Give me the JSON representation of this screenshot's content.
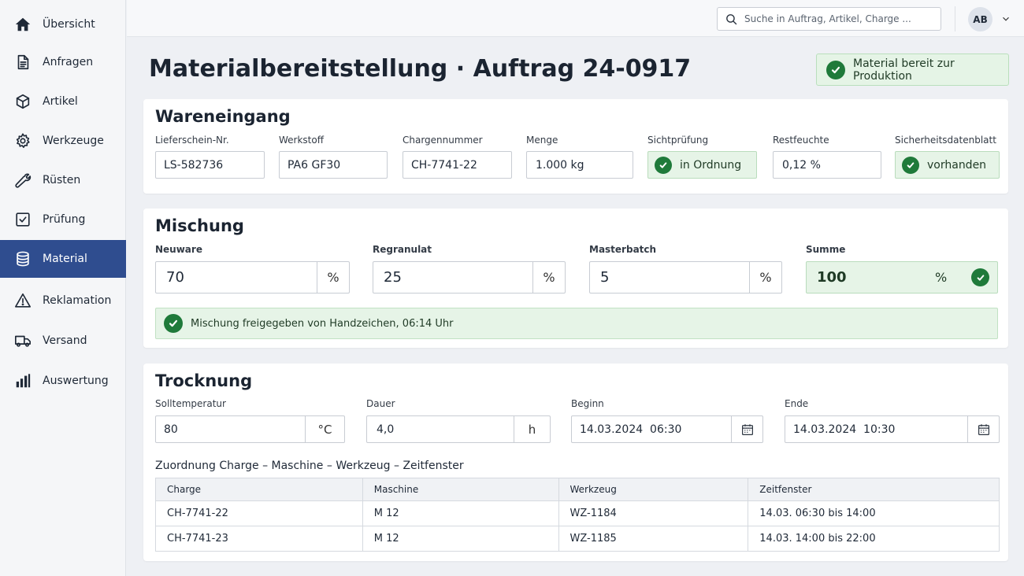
{
  "sidebar": {
    "items": [
      {
        "label": "Übersicht",
        "icon": "home-icon"
      },
      {
        "label": "Anfragen",
        "icon": "document-icon"
      },
      {
        "label": "Artikel",
        "icon": "box-icon"
      },
      {
        "label": "Werkzeuge",
        "icon": "gear-icon"
      },
      {
        "label": "Rüsten",
        "icon": "wrench-icon"
      },
      {
        "label": "Prüfung",
        "icon": "checkbox-icon"
      },
      {
        "label": "Material",
        "icon": "database-icon",
        "active": true
      },
      {
        "label": "Reklamation",
        "icon": "warning-icon"
      },
      {
        "label": "Versand",
        "icon": "truck-icon"
      },
      {
        "label": "Auswertung",
        "icon": "bar-chart-icon"
      }
    ]
  },
  "topbar": {
    "search_placeholder": "Suche in Auftrag, Artikel, Charge ...",
    "avatar_initials": "AB"
  },
  "page": {
    "title": "Materialbereitstellung · Auftrag 24-0917",
    "status": "Material bereit zur Produktion"
  },
  "wareneingang": {
    "heading": "Wareneingang",
    "lieferschein": {
      "label": "Lieferschein-Nr.",
      "value": "LS-582736"
    },
    "werkstoff": {
      "label": "Werkstoff",
      "value": "PA6 GF30"
    },
    "charge": {
      "label": "Chargennummer",
      "value": "CH-7741-22"
    },
    "menge": {
      "label": "Menge",
      "value": "1.000 kg"
    },
    "sichtpruefung": {
      "label": "Sichtprüfung",
      "value": "in Ordnung"
    },
    "restfeuchte": {
      "label": "Restfeuchte",
      "value": "0,12 %"
    },
    "sdb": {
      "label": "Sicherheitsdatenblatt",
      "value": "vorhanden"
    }
  },
  "mischung": {
    "heading": "Mischung",
    "neuware": {
      "label": "Neuware",
      "value": "70",
      "unit": "%"
    },
    "regranulat": {
      "label": "Regranulat",
      "value": "25",
      "unit": "%"
    },
    "masterbatch": {
      "label": "Masterbatch",
      "value": "5",
      "unit": "%"
    },
    "summe": {
      "label": "Summe",
      "value": "100",
      "unit": "%"
    },
    "banner": "Mischung freigegeben von Handzeichen, 06:14 Uhr"
  },
  "trocknung": {
    "heading": "Trocknung",
    "solltemperatur": {
      "label": "Solltemperatur",
      "value": "80",
      "unit": "°C"
    },
    "dauer": {
      "label": "Dauer",
      "value": "4,0",
      "unit": "h"
    },
    "beginn": {
      "label": "Beginn",
      "value": "14.03.2024  06:30"
    },
    "ende": {
      "label": "Ende",
      "value": "14.03.2024  10:30"
    },
    "table_title": "Zuordnung Charge – Maschine – Werkzeug – Zeitfenster",
    "columns": [
      "Charge",
      "Maschine",
      "Werkzeug",
      "Zeitfenster"
    ],
    "rows": [
      [
        "CH-7741-22",
        "M 12",
        "WZ-1184",
        "14.03. 06:30 bis 14:00"
      ],
      [
        "CH-7741-23",
        "M 12",
        "WZ-1185",
        "14.03. 14:00 bis 22:00"
      ]
    ]
  },
  "colors": {
    "accent": "#2f4d8f",
    "success": "#1f7a3a",
    "success_bg": "#e6f4e7"
  }
}
